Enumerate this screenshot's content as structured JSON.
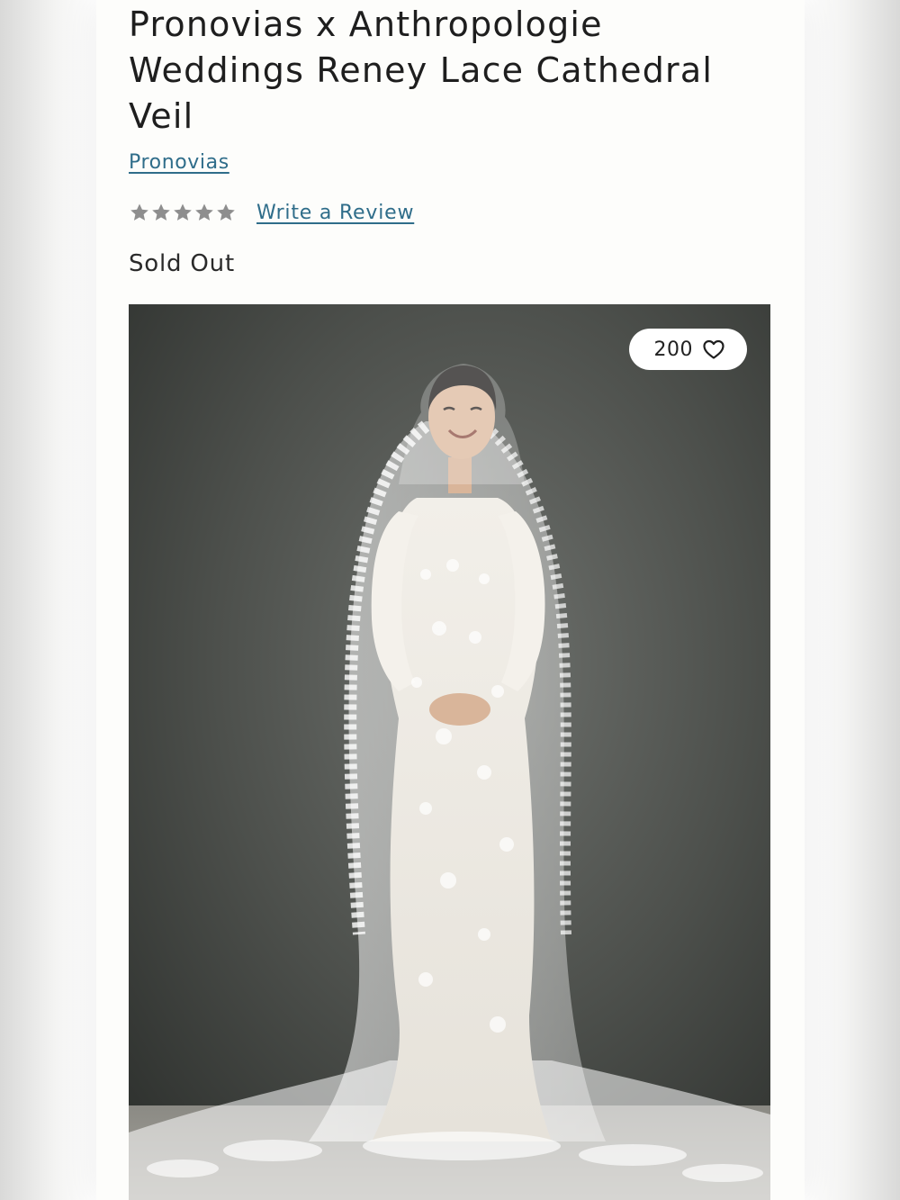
{
  "product": {
    "title": "Pronovias x Anthropologie Weddings Reney Lace Cathedral Veil",
    "brand": "Pronovias",
    "rating": {
      "stars_filled": 0,
      "stars_total": 5,
      "review_link": "Write a Review"
    },
    "availability": "Sold Out",
    "image": {
      "favorites_count": "200",
      "favorite_icon": "heart-outline-icon"
    }
  },
  "colors": {
    "link": "#2f6d8a",
    "star_empty": "#8e8e8e",
    "text": "#1e1e1e",
    "panel_bg": "#fdfdfb",
    "photo_bg": "#4a4d4a"
  }
}
